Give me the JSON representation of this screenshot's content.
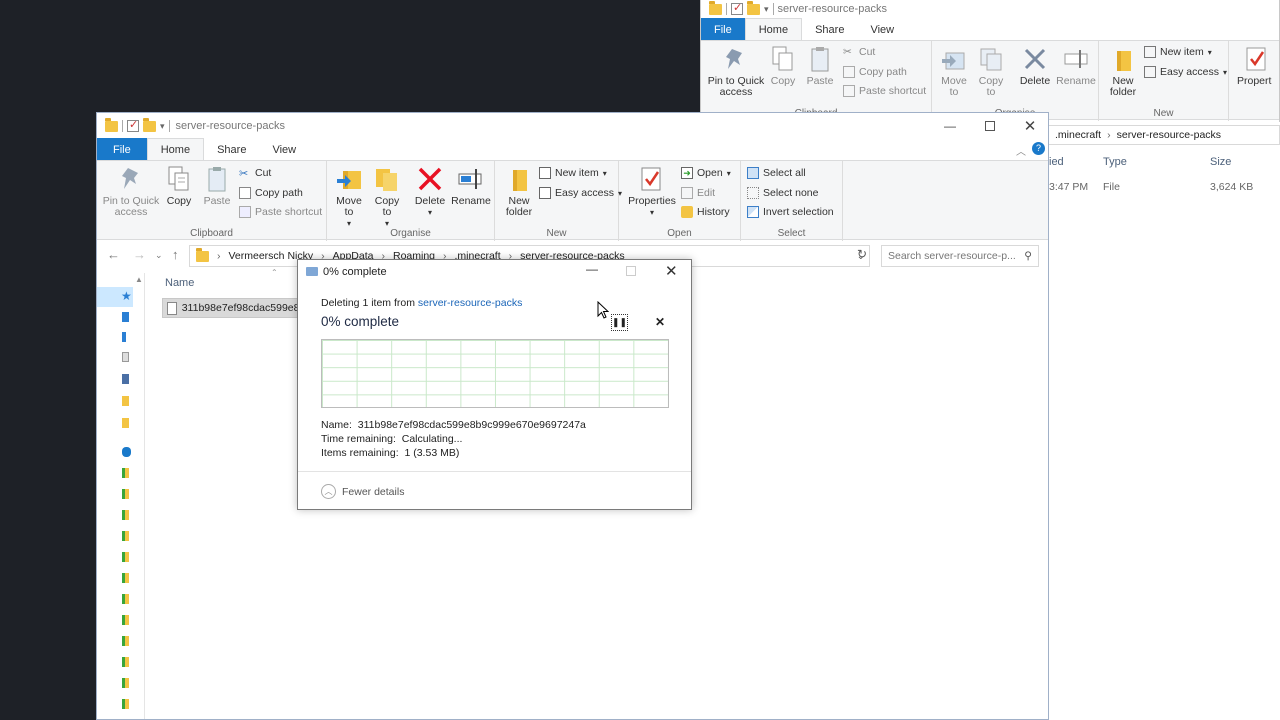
{
  "back_window": {
    "title": "server-resource-packs",
    "tabs": [
      "File",
      "Home",
      "Share",
      "View"
    ],
    "clipboard": {
      "pin": "Pin to Quick access",
      "copy": "Copy",
      "paste": "Paste",
      "cut": "Cut",
      "copy_path": "Copy path",
      "paste_shortcut": "Paste shortcut",
      "group": "Clipboard"
    },
    "organise": {
      "move_to": "Move to",
      "copy_to": "Copy to",
      "delete": "Delete",
      "rename": "Rename",
      "group": "Organise"
    },
    "new": {
      "new_folder": "New folder",
      "new_item": "New item",
      "easy_access": "Easy access",
      "group": "New"
    },
    "open": {
      "properties": "Propert"
    },
    "breadcrumb": [
      ".minecraft",
      "server-resource-packs"
    ],
    "columns": {
      "modified": "ied",
      "type": "Type",
      "size": "Size"
    },
    "row": {
      "modified": "3:47 PM",
      "type": "File",
      "size": "3,624 KB"
    }
  },
  "front_window": {
    "title": "server-resource-packs",
    "tabs": [
      "File",
      "Home",
      "Share",
      "View"
    ],
    "clipboard": {
      "pin": "Pin to Quick access",
      "copy": "Copy",
      "paste": "Paste",
      "cut": "Cut",
      "copy_path": "Copy path",
      "paste_shortcut": "Paste shortcut",
      "group": "Clipboard"
    },
    "organise": {
      "move_to": "Move to",
      "copy_to": "Copy to",
      "delete": "Delete",
      "rename": "Rename",
      "group": "Organise"
    },
    "new": {
      "new_folder": "New folder",
      "new_item": "New item",
      "easy_access": "Easy access",
      "group": "New"
    },
    "open": {
      "properties": "Properties",
      "open": "Open",
      "edit": "Edit",
      "history": "History",
      "group": "Open"
    },
    "select": {
      "select_all": "Select all",
      "select_none": "Select none",
      "invert": "Invert selection",
      "group": "Select"
    },
    "breadcrumb": [
      "Vermeersch Nicky",
      "AppData",
      "Roaming",
      ".minecraft",
      "server-resource-packs"
    ],
    "search_placeholder": "Search server-resource-p...",
    "column_name": "Name",
    "file_name": "311b98e7ef98cdac599e8b"
  },
  "dialog": {
    "title": "0% complete",
    "deleting_prefix": "Deleting 1 item from ",
    "deleting_link": "server-resource-packs",
    "heading": "0% complete",
    "progress": 0,
    "name_label": "Name:",
    "name_value": "311b98e7ef98cdac599e8b9c999e670e9697247a",
    "time_label": "Time remaining:",
    "time_value": "Calculating...",
    "items_label": "Items remaining:",
    "items_value": "1 (3.53 MB)",
    "fewer_details": "Fewer details"
  },
  "colors": {
    "accent": "#1979ca",
    "delete_red": "#e81123",
    "folder": "#f3c443",
    "progress_grid": "#c9e8c9"
  }
}
